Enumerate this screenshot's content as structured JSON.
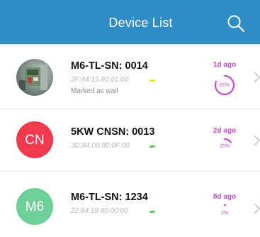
{
  "header": {
    "title": "Device List",
    "background": "#2e8cc6"
  },
  "accent_color": "#c64bd0",
  "devices": [
    {
      "name": "M6-TL-SN: 0014",
      "mac": "2F:84:15:80:01:00",
      "note": "Marked as wall",
      "avatar": {
        "type": "photo",
        "initials": ""
      },
      "last_seen": "1d ago",
      "percent": 81,
      "percent_label": "81%",
      "leaf_color": "#e3e832"
    },
    {
      "name": "5KW CNSN: 0013",
      "mac": "3D:84:09:80:0F:00",
      "note": "",
      "avatar": {
        "type": "initials",
        "initials": "CN",
        "color": "#f0394c"
      },
      "last_seen": "2d ago",
      "percent": 15,
      "percent_label": "15%",
      "leaf_color": "#60c95a"
    },
    {
      "name": "M6-TL-SN: 1234",
      "mac": "22:84:19:80:00:00",
      "note": "",
      "avatar": {
        "type": "initials",
        "initials": "M6",
        "color": "#6cd098"
      },
      "last_seen": "8d ago",
      "percent": 2,
      "percent_label": "2%",
      "leaf_color": "#60c95a"
    }
  ]
}
